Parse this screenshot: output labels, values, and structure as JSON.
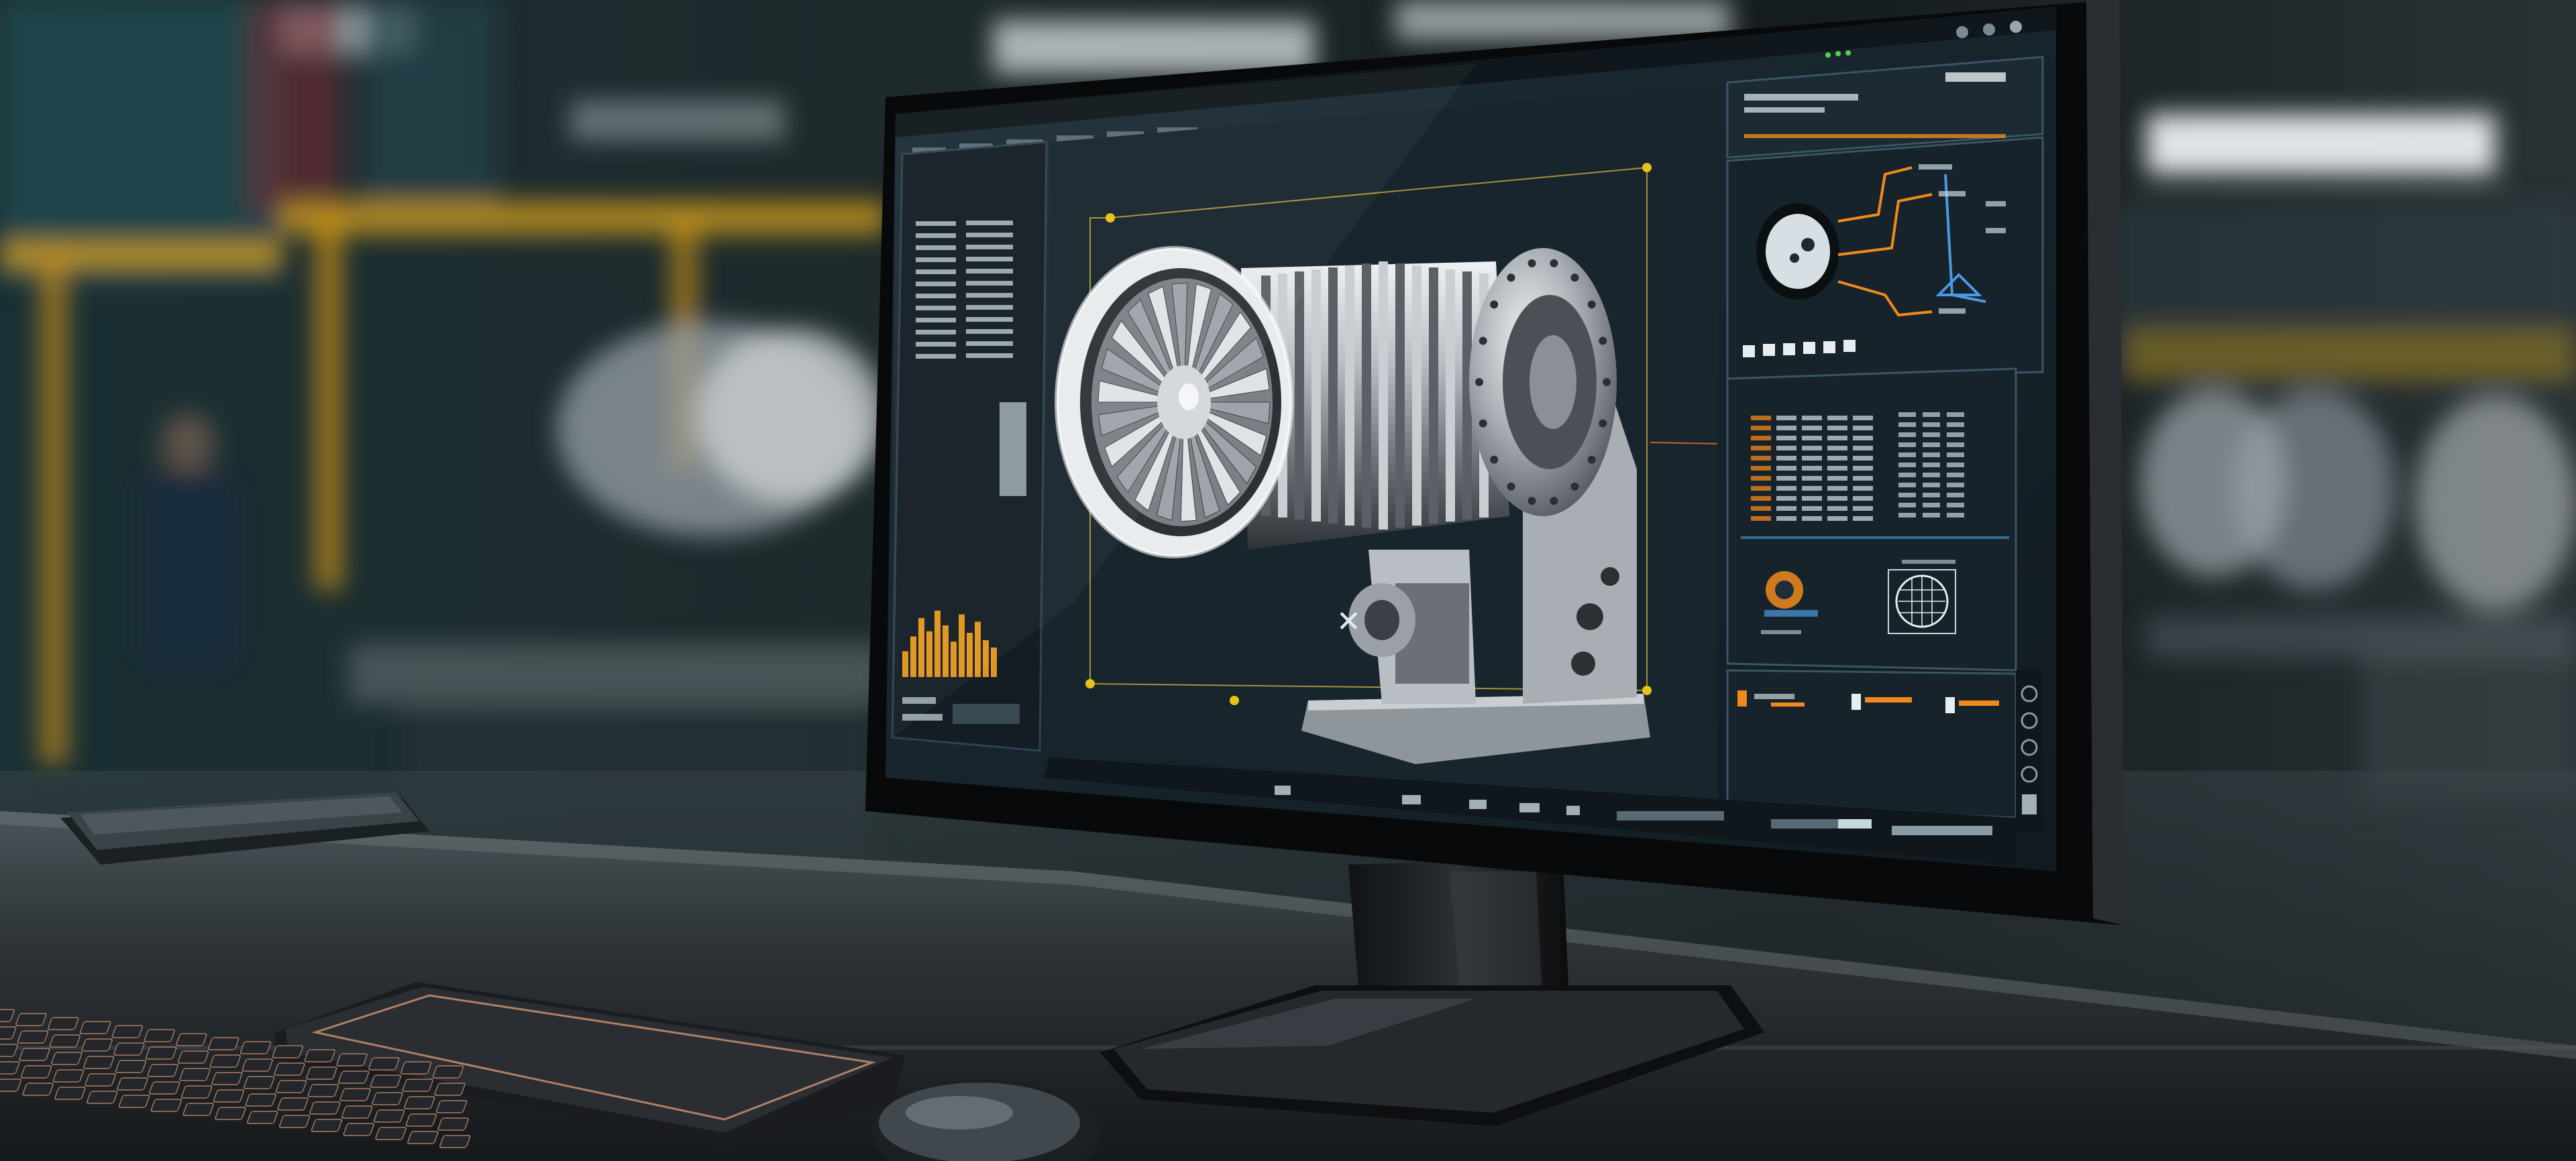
{
  "scene": {
    "description_tags": [
      "factory-background",
      "desk",
      "monitor",
      "cad-software",
      "turbine-model",
      "keyboard",
      "mouse",
      "tablet"
    ]
  },
  "colors": {
    "background_dark": "#0d1418",
    "factory_teal": "#1d3a40",
    "factory_yellow": "#d8a21c",
    "monitor_bezel": "#0a0b0d",
    "screen_bg": "#16222a",
    "panel_bg": "#1b2a33",
    "panel_border": "#3a5664",
    "accent_orange": "#f08a1c",
    "accent_yellow": "#e6c21a",
    "text_light": "#c8d6de",
    "metal_light": "#d9dde0",
    "metal_mid": "#8a9096",
    "metal_dark": "#3c4248",
    "desk_top": "#2a3034"
  },
  "icons": {
    "window": [
      "minimize-icon",
      "maximize-icon",
      "close-icon"
    ],
    "viewport_toolbar": [
      "rotate-icon",
      "pan-icon",
      "zoom-icon",
      "grid-icon",
      "view-icon"
    ],
    "side_toolbar": [
      "select-icon",
      "move-icon",
      "measure-icon",
      "section-icon",
      "render-icon"
    ]
  },
  "panels": {
    "bar_chart_levels": [
      0.35,
      0.55,
      0.8,
      0.62,
      0.9,
      0.7,
      0.48,
      0.85,
      0.6,
      0.75,
      0.5,
      0.4
    ]
  }
}
